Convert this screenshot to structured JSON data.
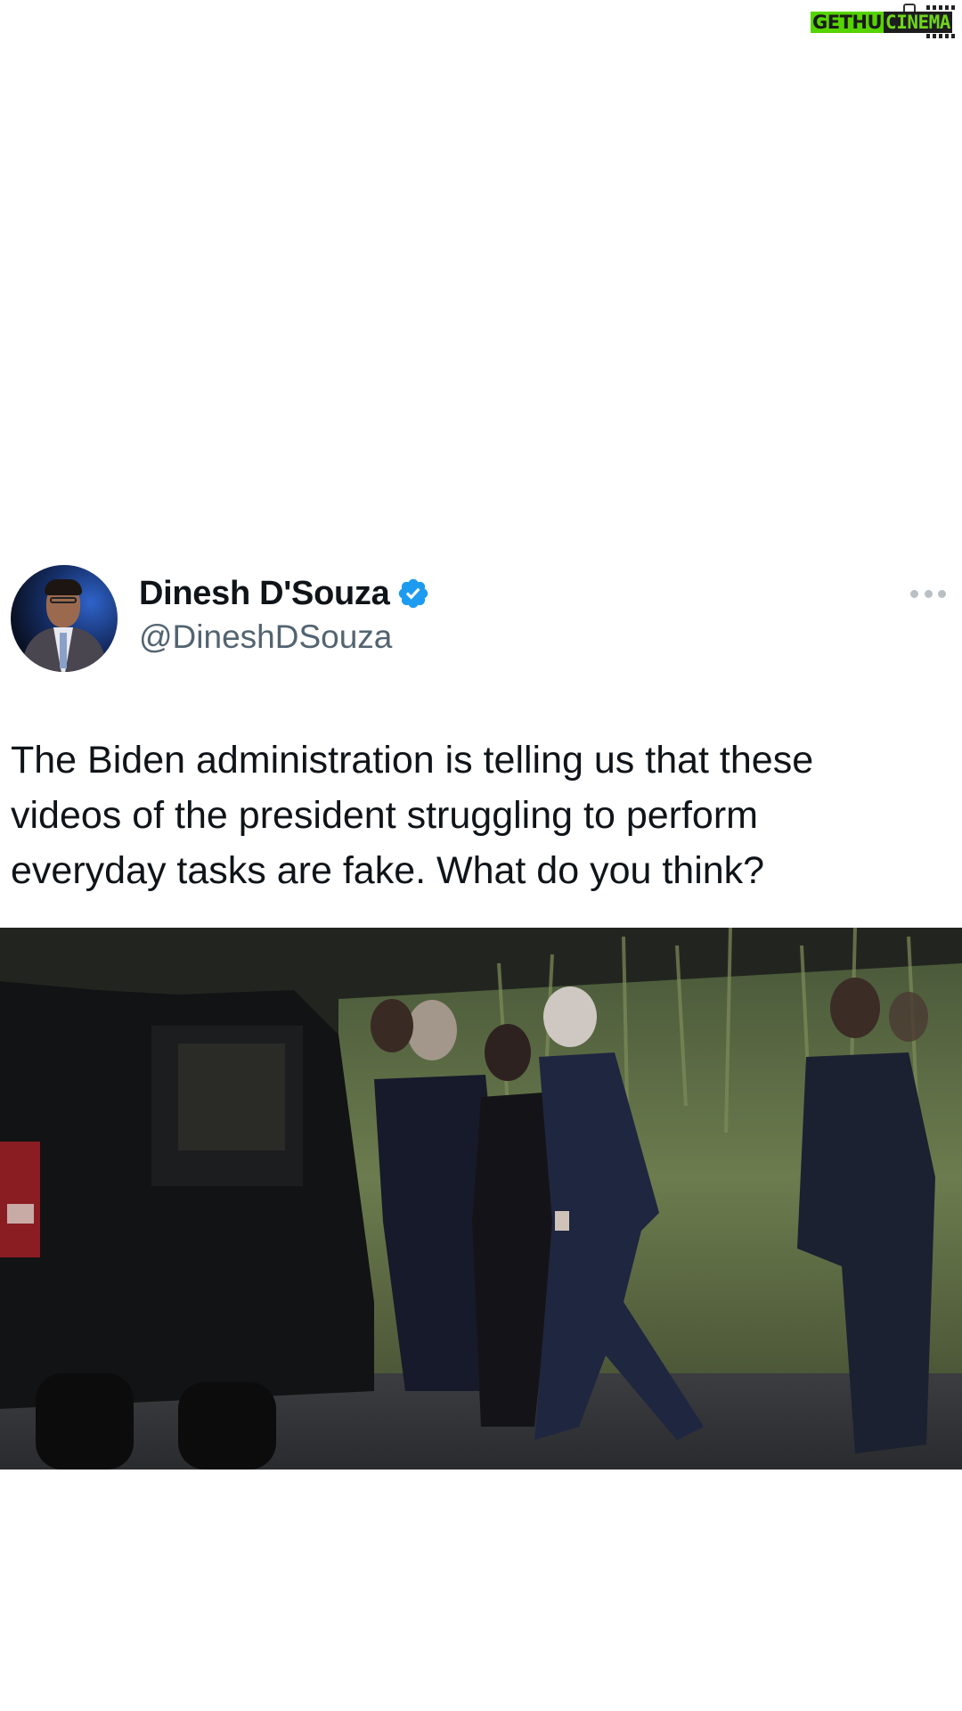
{
  "watermark": {
    "part1": "GETHU",
    "part2": "CINEMA"
  },
  "tweet": {
    "author_name": "Dinesh D'Souza",
    "author_handle": "@DineshDSouza",
    "verified": true,
    "text": "The Biden administration is telling us that these videos of the president struggling to perform everyday tasks are fake. What do you think?",
    "text_lines": [
      "The Biden administration is telling us that these",
      "videos of the president struggling to perform",
      "everyday tasks are fake. What do you think?"
    ]
  },
  "icons": {
    "verified": "verified-badge-icon",
    "more": "more-options-icon"
  },
  "colors": {
    "text_primary": "#0f1419",
    "text_secondary": "#536471",
    "verified_blue": "#1d9bf0",
    "watermark_green": "#55d400"
  }
}
